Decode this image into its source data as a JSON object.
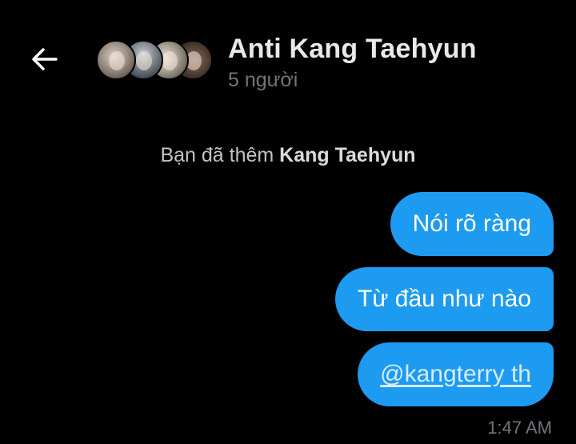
{
  "header": {
    "back_icon": "arrow-left-icon",
    "title": "Anti Kang Taehyun",
    "member_count": "5 người",
    "avatar_count": 4
  },
  "conversation": {
    "system_message": {
      "prefix": "Bạn đã thêm ",
      "name": "Kang Taehyun"
    },
    "messages": [
      {
        "text": "Nói rõ ràng",
        "is_mention": false
      },
      {
        "text": "Từ đầu như nào",
        "is_mention": false
      },
      {
        "text": "@kangterry th",
        "is_mention": true
      }
    ],
    "last_timestamp": "1:47 AM"
  },
  "colors": {
    "background": "#000000",
    "bubble": "#1d9bf0",
    "muted_text": "#71767b",
    "primary_text": "#e7e9ea"
  }
}
